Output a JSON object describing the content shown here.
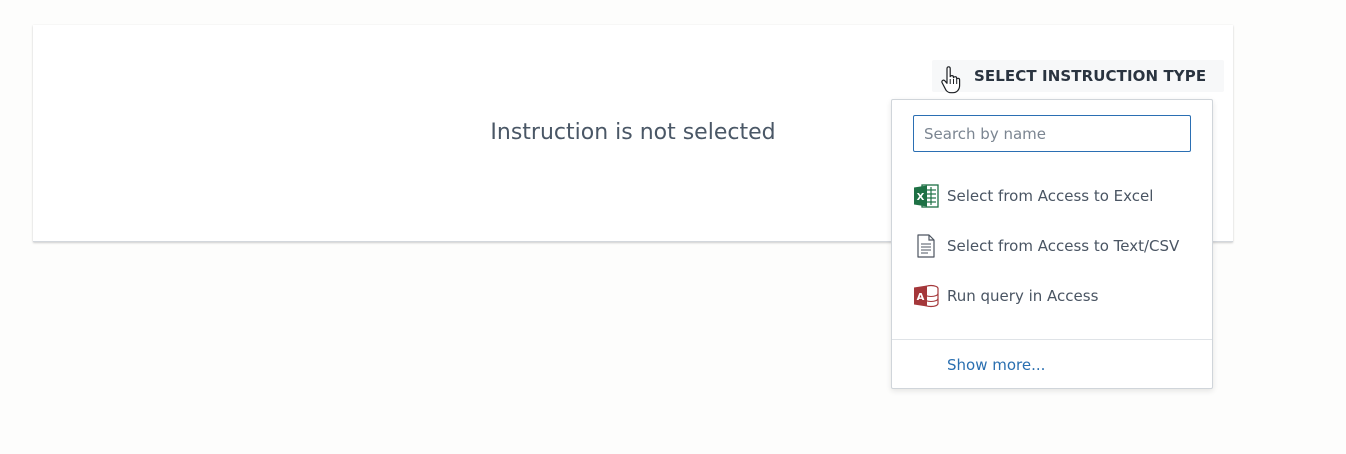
{
  "panel": {
    "empty_message": "Instruction is not selected"
  },
  "select_button": {
    "label": "SELECT INSTRUCTION TYPE"
  },
  "dropdown": {
    "search_placeholder": "Search by name",
    "search_value": "",
    "items": [
      {
        "label": "Select from Access to Excel",
        "icon": "excel-icon"
      },
      {
        "label": "Select from Access to Text/CSV",
        "icon": "text-file-icon"
      },
      {
        "label": "Run query in Access",
        "icon": "access-icon"
      }
    ],
    "show_more": "Show more..."
  },
  "colors": {
    "excel_green": "#1e7145",
    "access_red": "#a4373a",
    "link_blue": "#2a6fb0",
    "focus_border": "#2b6fb3"
  }
}
